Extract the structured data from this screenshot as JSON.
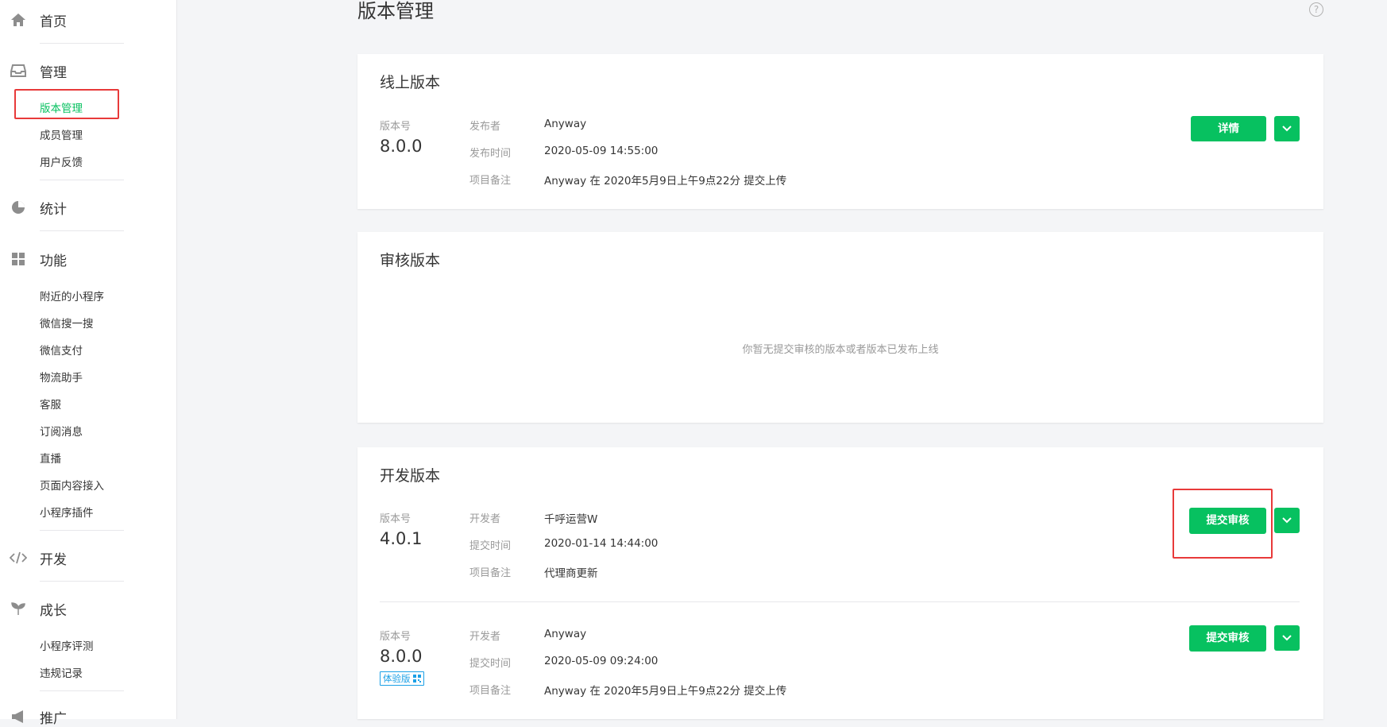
{
  "sidebar": {
    "home": "首页",
    "manage": "管理",
    "manage_items": [
      "版本管理",
      "成员管理",
      "用户反馈"
    ],
    "stats": "统计",
    "features": "功能",
    "feature_items": [
      "附近的小程序",
      "微信搜一搜",
      "微信支付",
      "物流助手",
      "客服",
      "订阅消息",
      "直播",
      "页面内容接入",
      "小程序插件"
    ],
    "dev": "开发",
    "growth": "成长",
    "growth_items": [
      "小程序评测",
      "违规记录"
    ],
    "promo": "推广"
  },
  "page": {
    "title": "版本管理",
    "help": "?"
  },
  "online": {
    "title": "线上版本",
    "version_label": "版本号",
    "version": "8.0.0",
    "publisher_label": "发布者",
    "publisher": "Anyway",
    "time_label": "发布时间",
    "time": "2020-05-09 14:55:00",
    "note_label": "项目备注",
    "note": "Anyway 在 2020年5月9日上午9点22分 提交上传",
    "details_button": "详情"
  },
  "review": {
    "title": "审核版本",
    "empty": "你暂无提交审核的版本或者版本已发布上线"
  },
  "develop": {
    "title": "开发版本",
    "items": [
      {
        "version_label": "版本号",
        "version": "4.0.1",
        "dev_label": "开发者",
        "dev": "千呼运营W",
        "time_label": "提交时间",
        "time": "2020-01-14 14:44:00",
        "note_label": "项目备注",
        "note": "代理商更新",
        "submit_button": "提交审核"
      },
      {
        "version_label": "版本号",
        "version": "8.0.0",
        "tag": "体验版",
        "dev_label": "开发者",
        "dev": "Anyway",
        "time_label": "提交时间",
        "time": "2020-05-09 09:24:00",
        "note_label": "项目备注",
        "note": "Anyway 在 2020年5月9日上午9点22分 提交上传",
        "submit_button": "提交审核"
      }
    ]
  },
  "colors": {
    "accent": "#07c160",
    "highlight": "#e83a3a",
    "tag": "#1ba0e6"
  }
}
